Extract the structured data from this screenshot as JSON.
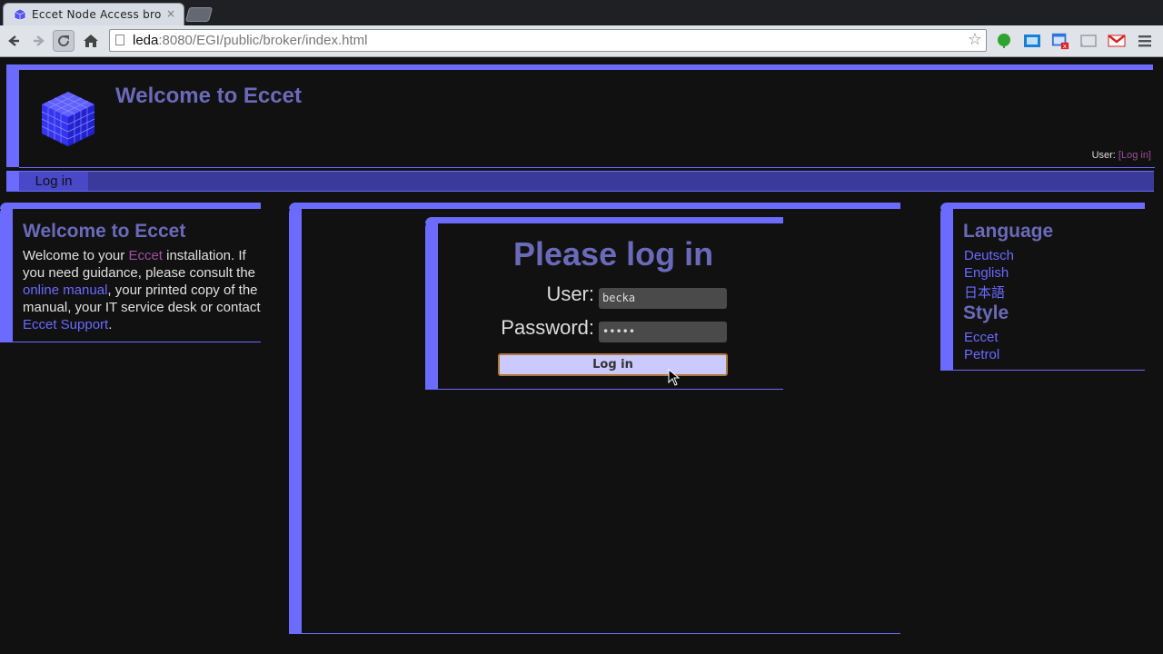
{
  "browser": {
    "tab_title": "Eccet Node Access bro",
    "tab_close": "×",
    "url_host": "leda",
    "url_rest": ":8080/EGI/public/broker/index.html"
  },
  "header": {
    "site_title": "Welcome to Eccet",
    "user_label": "User: ",
    "user_login_link": "[Log in]"
  },
  "menu": {
    "login": "Log in"
  },
  "left_panel": {
    "title": "Welcome to Eccet",
    "text_1": "Welcome to your ",
    "link_eccet": "Eccet",
    "text_2": " installation. If you need guidance, please consult the ",
    "link_manual": "online manual",
    "text_3": ", your printed copy of the manual, your IT service desk or contact ",
    "link_support": "Eccet Support",
    "text_4": "."
  },
  "login": {
    "title": "Please log in",
    "user_label": "User:",
    "user_value": "becka",
    "password_label": "Password:",
    "password_value": "•••••",
    "button_label": "Log in"
  },
  "right_panel": {
    "language_heading": "Language",
    "languages": [
      "Deutsch",
      "English",
      "日本語"
    ],
    "style_heading": "Style",
    "styles": [
      "Eccet",
      "Petrol"
    ]
  },
  "colors": {
    "accent": "#6b6bff",
    "heading": "#6a6aba",
    "background": "#111111",
    "button_bg": "#cacaff"
  }
}
